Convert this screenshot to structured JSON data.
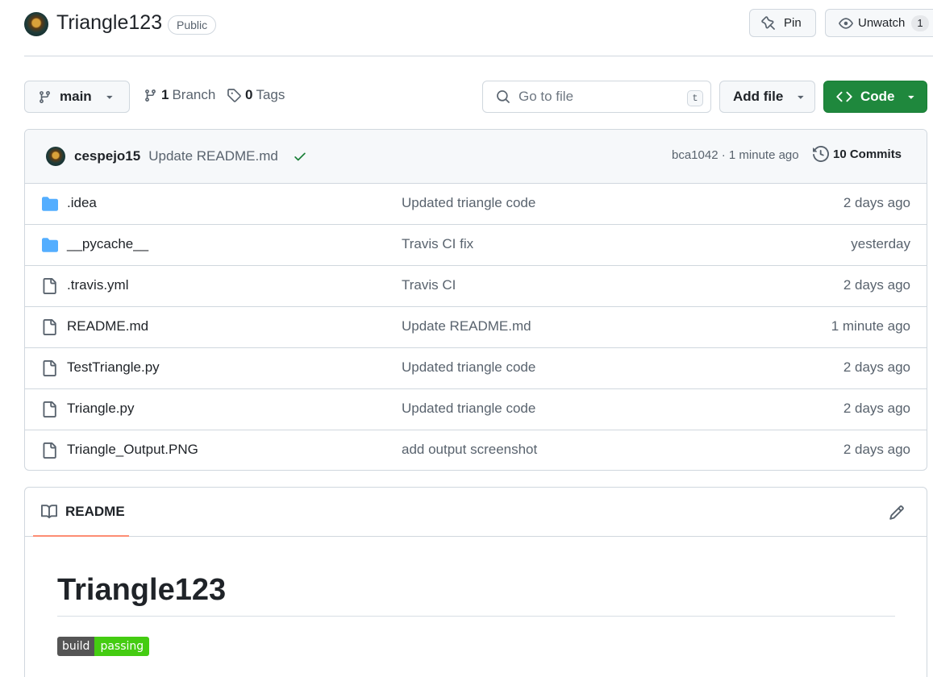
{
  "repo": {
    "name": "Triangle123",
    "visibility": "Public",
    "pin_label": "Pin",
    "watch_label": "Unwatch",
    "watch_count": "1"
  },
  "toolbar": {
    "branch": "main",
    "branches_count": "1",
    "branches_label": "Branch",
    "tags_count": "0",
    "tags_label": "Tags",
    "search_placeholder": "Go to file",
    "search_shortcut": "t",
    "add_file_label": "Add file",
    "code_label": "Code"
  },
  "commit": {
    "author": "cespejo15",
    "message": "Update README.md",
    "sha_time": "bca1042 · 1 minute ago",
    "commits_label": "10 Commits"
  },
  "files": [
    {
      "type": "folder",
      "name": ".idea",
      "message": "Updated triangle code",
      "age": "2 days ago"
    },
    {
      "type": "folder",
      "name": "__pycache__",
      "message": "Travis CI fix",
      "age": "yesterday"
    },
    {
      "type": "file",
      "name": ".travis.yml",
      "message": "Travis CI",
      "age": "2 days ago"
    },
    {
      "type": "file",
      "name": "README.md",
      "message": "Update README.md",
      "age": "1 minute ago"
    },
    {
      "type": "file",
      "name": "TestTriangle.py",
      "message": "Updated triangle code",
      "age": "2 days ago"
    },
    {
      "type": "file",
      "name": "Triangle.py",
      "message": "Updated triangle code",
      "age": "2 days ago"
    },
    {
      "type": "file",
      "name": "Triangle_Output.PNG",
      "message": "add output screenshot",
      "age": "2 days ago"
    }
  ],
  "readme": {
    "tab_label": "README",
    "title": "Triangle123",
    "badge_left": "build",
    "badge_right": "passing"
  },
  "colors": {
    "code_button": "#1f883d",
    "folder_icon": "#54aeff",
    "check": "#1a7f37",
    "tab_underline": "#fd8c73",
    "badge_passing": "#44cc11"
  }
}
